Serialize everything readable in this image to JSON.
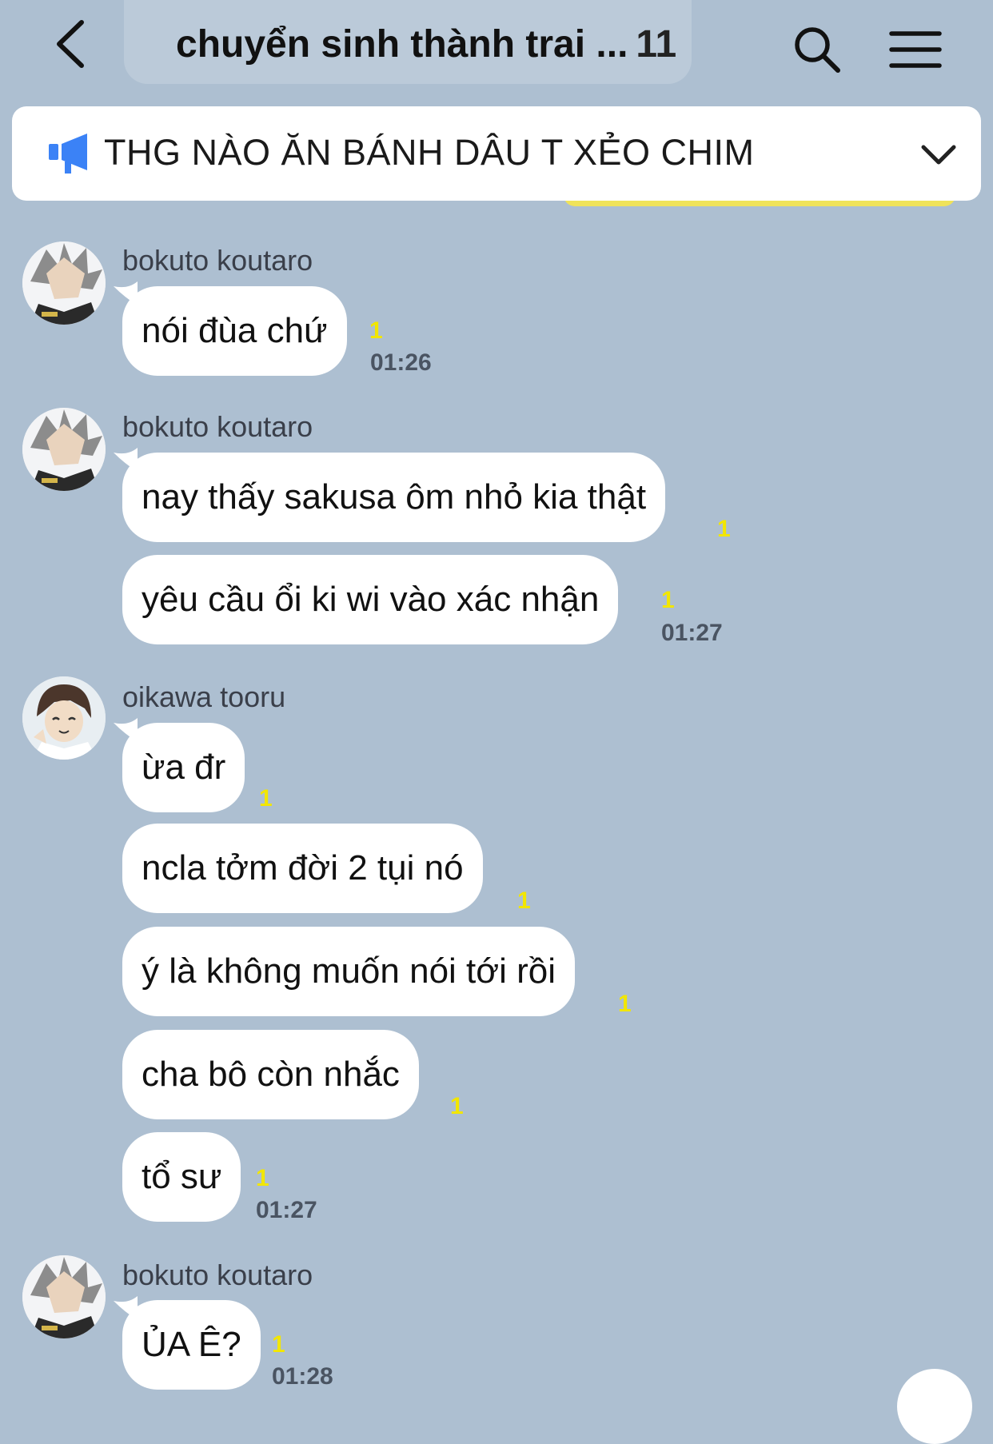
{
  "header": {
    "title": "chuyển sinh thành trai ...",
    "member_count": "11",
    "back_icon": "chevron-left-icon",
    "search_icon": "search-icon",
    "menu_icon": "hamburger-menu-icon"
  },
  "announcement": {
    "text": "THG NÀO ĂN BÁNH DÂU T XẺO CHIM",
    "icon": "megaphone-icon",
    "toggle_icon": "chevron-down-icon"
  },
  "colors": {
    "background": "#adbfd1",
    "bubble": "#ffffff",
    "read_receipt": "#f2e600",
    "megaphone": "#3b82f6"
  },
  "messages": [
    {
      "sender": "bokuto koutaro",
      "text": "nói đùa chứ",
      "read": "1",
      "time": "01:26"
    },
    {
      "sender": "bokuto koutaro",
      "text": "nay thấy sakusa ôm nhỏ kia thật",
      "read": "1",
      "time": ""
    },
    {
      "sender": "",
      "text": "yêu cầu ổi ki wi vào xác nhận",
      "read": "1",
      "time": "01:27"
    },
    {
      "sender": "oikawa tooru",
      "text": "ừa đr",
      "read": "1",
      "time": ""
    },
    {
      "sender": "",
      "text": "ncla tởm đời 2 tụi nó",
      "read": "1",
      "time": ""
    },
    {
      "sender": "",
      "text": "ý là không muốn nói tới rồi",
      "read": "1",
      "time": ""
    },
    {
      "sender": "",
      "text": "cha bô còn nhắc",
      "read": "1",
      "time": ""
    },
    {
      "sender": "",
      "text": "tổ sư",
      "read": "1",
      "time": "01:27"
    },
    {
      "sender": "bokuto koutaro",
      "text": "ỦA Ê?",
      "read": "1",
      "time": "01:28"
    }
  ]
}
